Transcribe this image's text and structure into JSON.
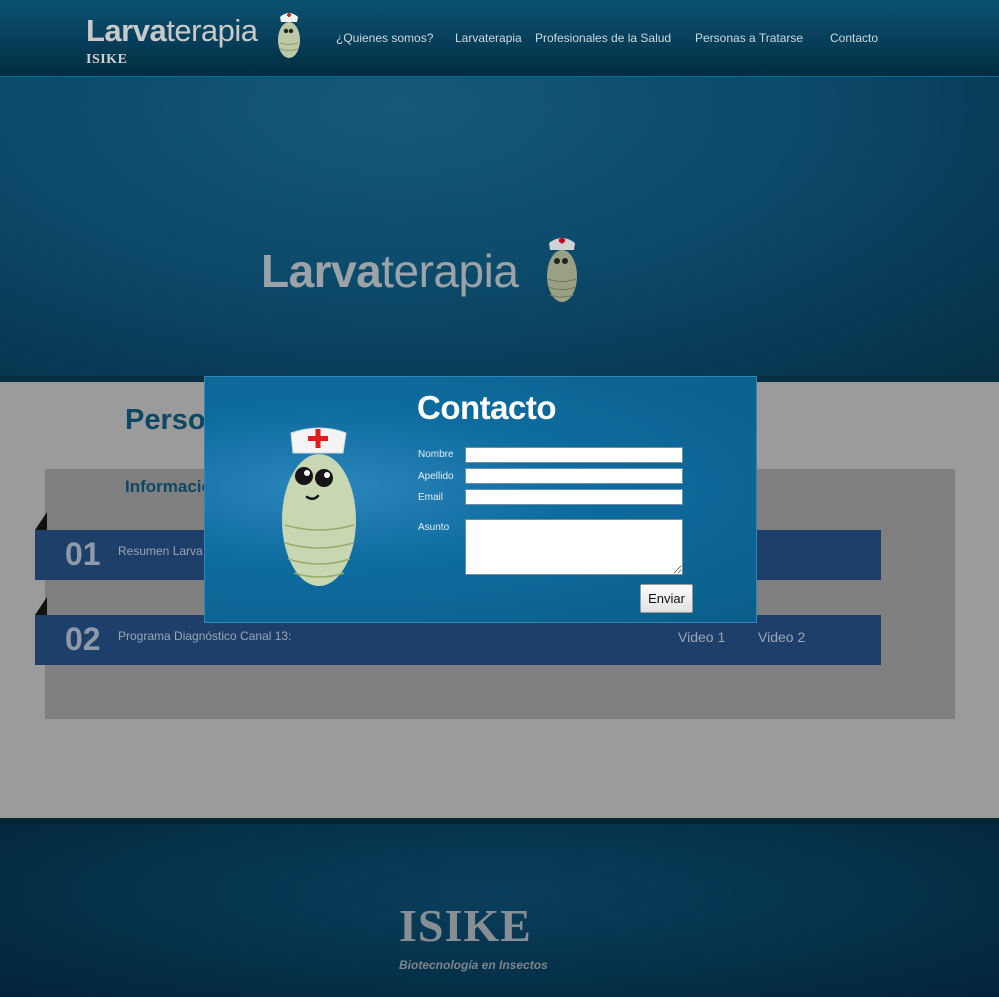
{
  "header": {
    "logo": {
      "bold": "Larva",
      "light": "terapia",
      "sub": "ISIKE"
    },
    "nav": [
      "¿Quienes somos?",
      "Larvaterapia",
      "Profesionales de la Salud",
      "Personas a Tratarse",
      "Contacto"
    ]
  },
  "hero": {
    "logo": {
      "bold": "Larva",
      "light": "terapia"
    }
  },
  "main": {
    "title": "Person",
    "info_title": "Informació",
    "rows": [
      {
        "num": "01",
        "text": "Resumen Larva"
      },
      {
        "num": "02",
        "text": "Programa Diagnóstico Canal 13:",
        "video1": "Video 1",
        "video2": "Video 2"
      }
    ]
  },
  "footer": {
    "logo": "ISIKE",
    "tagline": "Biotecnología en Insectos"
  },
  "modal": {
    "title": "Contacto",
    "fields": {
      "nombre": "Nombre",
      "apellido": "Apellido",
      "email": "Email",
      "asunto": "Asunto"
    },
    "submit": "Enviar"
  },
  "colors": {
    "brand_blue": "#0a5e8b",
    "header_dark": "#032c40",
    "row_blue": "#1f3f6b"
  },
  "icons": {
    "mascot": "nurse-larva-icon"
  }
}
